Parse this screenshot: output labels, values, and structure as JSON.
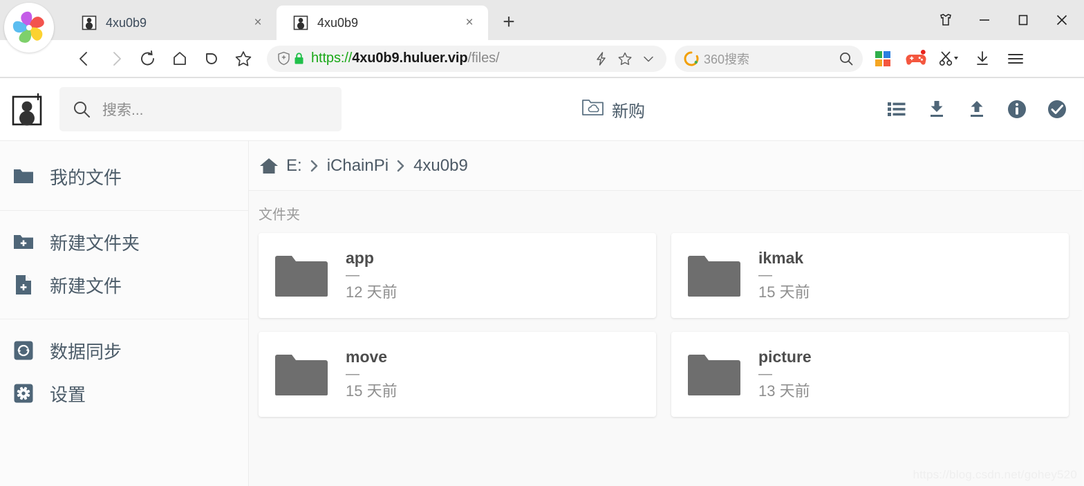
{
  "browser": {
    "tabs": [
      {
        "title": "4xu0b9",
        "favicon": "user-silhouette-icon",
        "active": false,
        "close_label": "×"
      },
      {
        "title": "4xu0b9",
        "favicon": "user-silhouette-icon",
        "active": true,
        "close_label": "×"
      }
    ],
    "new_tab_label": "+",
    "window_controls": {
      "shirt_label": "",
      "minimize_label": "—",
      "maximize_label": "",
      "close_label": ""
    },
    "nav": {
      "back": "back-arrow",
      "forward": "forward-arrow",
      "reload": "reload",
      "home": "home",
      "undo": "undo",
      "favorite": "star"
    },
    "url": {
      "scheme": "https://",
      "host": "4xu0b9.huluer.vip",
      "path": "/files/",
      "shield_icon": "shield-plus-icon",
      "lock_icon": "lock-icon"
    },
    "search": {
      "engine_label": "360搜索",
      "engine_icon": "360-logo-icon",
      "go_icon": "search-icon"
    },
    "extensions": [
      {
        "name": "apps-grid-icon"
      },
      {
        "name": "gamepad-icon"
      },
      {
        "name": "scissors-icon"
      },
      {
        "name": "downloads-icon"
      },
      {
        "name": "menu-icon"
      }
    ]
  },
  "app": {
    "logo_icon": "add-user-icon",
    "search": {
      "placeholder": "搜索...",
      "value": ""
    },
    "buy": {
      "label": "新购",
      "icon": "folder-cloud-icon"
    },
    "actions": [
      {
        "name": "list-view-icon"
      },
      {
        "name": "download-icon"
      },
      {
        "name": "upload-icon"
      },
      {
        "name": "info-icon"
      },
      {
        "name": "check-circle-icon"
      }
    ],
    "sidebar": {
      "groups": [
        {
          "items": [
            {
              "label": "我的文件",
              "icon": "folder-icon"
            }
          ]
        },
        {
          "items": [
            {
              "label": "新建文件夹",
              "icon": "folder-plus-icon"
            },
            {
              "label": "新建文件",
              "icon": "file-plus-icon"
            }
          ]
        },
        {
          "items": [
            {
              "label": "数据同步",
              "icon": "sync-icon"
            },
            {
              "label": "设置",
              "icon": "gear-icon"
            }
          ]
        }
      ]
    },
    "breadcrumb": {
      "home_icon": "home-icon",
      "separator": "›",
      "items": [
        "E:",
        "iChainPi",
        "4xu0b9"
      ]
    },
    "section_label": "文件夹",
    "folders": [
      {
        "name": "app",
        "size": "—",
        "modified": "12 天前",
        "icon": "folder-icon"
      },
      {
        "name": "ikmak",
        "size": "—",
        "modified": "15 天前",
        "icon": "folder-icon"
      },
      {
        "name": "move",
        "size": "—",
        "modified": "15 天前",
        "icon": "folder-icon"
      },
      {
        "name": "picture",
        "size": "—",
        "modified": "13 天前",
        "icon": "folder-icon"
      }
    ],
    "watermark": "https://blog.csdn.net/gohey520"
  },
  "colors": {
    "accent_slate": "#4f6678",
    "folder_gray": "#6e6e6e",
    "url_secure_green": "#1aa817",
    "content_bg": "#f9f9f9"
  }
}
